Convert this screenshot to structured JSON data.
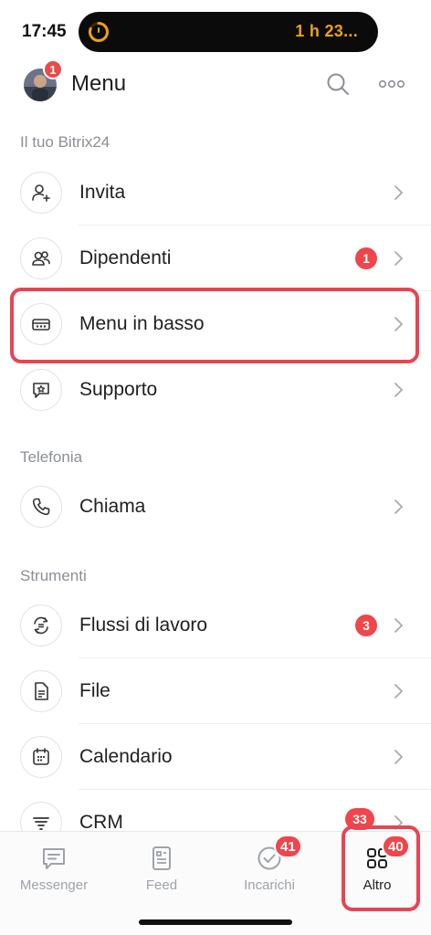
{
  "status": {
    "time": "17:45",
    "timer": "1 h 23..."
  },
  "header": {
    "title": "Menu",
    "avatar_badge": "1"
  },
  "sections": [
    {
      "title": "Il tuo Bitrix24"
    },
    {
      "title": "Telefonia"
    },
    {
      "title": "Strumenti"
    }
  ],
  "items": [
    {
      "label": "Invita",
      "icon": "person-add-icon"
    },
    {
      "label": "Dipendenti",
      "icon": "people-icon",
      "badge": "1"
    },
    {
      "label": "Menu in basso",
      "icon": "bottom-menu-icon"
    },
    {
      "label": "Supporto",
      "icon": "support-chat-icon"
    },
    {
      "label": "Chiama",
      "icon": "phone-icon"
    },
    {
      "label": "Flussi di lavoro",
      "icon": "workflow-icon",
      "badge": "3"
    },
    {
      "label": "File",
      "icon": "file-icon"
    },
    {
      "label": "Calendario",
      "icon": "calendar-icon"
    },
    {
      "label": "CRM",
      "icon": "crm-icon",
      "badge": "33"
    }
  ],
  "tabs": [
    {
      "label": "Messenger",
      "icon": "chat-icon"
    },
    {
      "label": "Feed",
      "icon": "feed-icon"
    },
    {
      "label": "Incarichi",
      "icon": "check-circle-icon",
      "badge": "41"
    },
    {
      "label": "Altro",
      "icon": "grid-icon",
      "badge": "40",
      "active": true
    }
  ],
  "colors": {
    "accent_red": "#e84551",
    "badge_red": "#f0454b",
    "timer_orange": "#f0a20a"
  }
}
